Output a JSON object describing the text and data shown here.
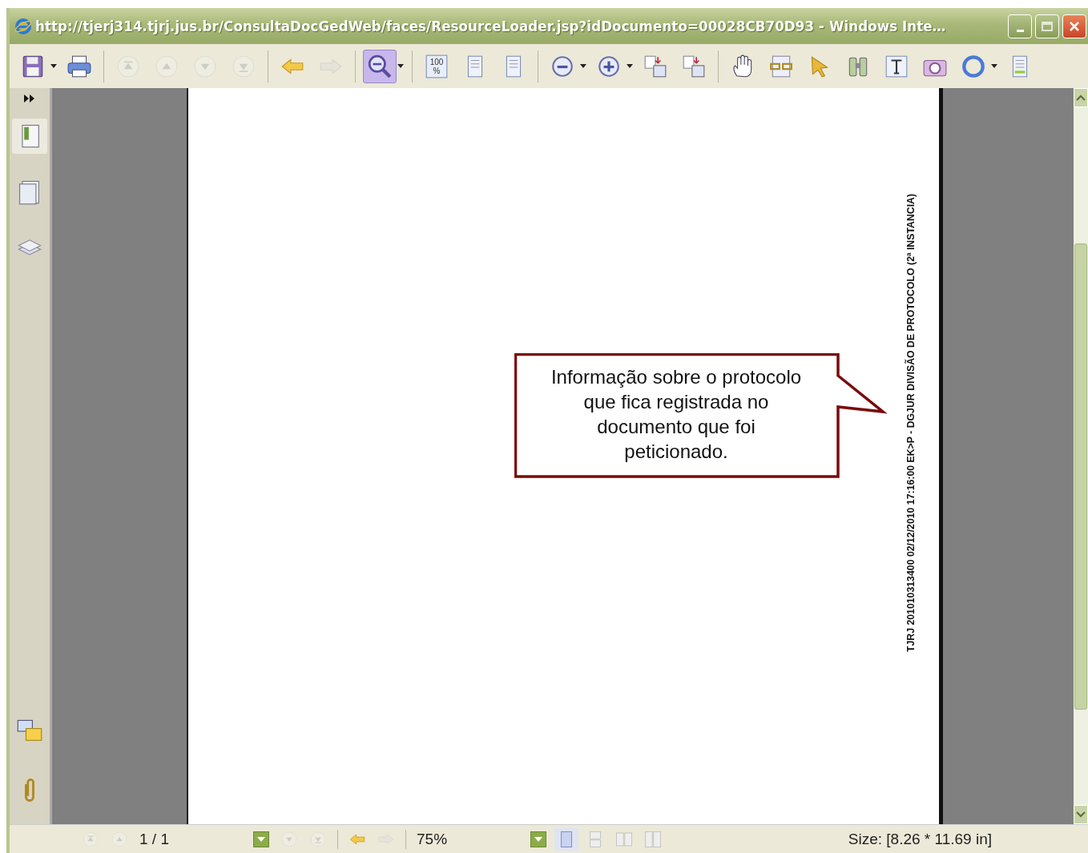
{
  "window": {
    "title": "http://tjerj314.tjrj.jus.br/ConsultaDocGedWeb/faces/ResourceLoader.jsp?idDocumento=00028CB70D93 - Windows Inte…"
  },
  "toolbar": [
    {
      "kind": "save",
      "disabled": false,
      "selected": false,
      "dropdown": true
    },
    {
      "kind": "print",
      "disabled": false,
      "selected": false
    },
    {
      "kind": "separator"
    },
    {
      "kind": "first",
      "disabled": true,
      "selected": false
    },
    {
      "kind": "prev",
      "disabled": true,
      "selected": false
    },
    {
      "kind": "next",
      "disabled": true,
      "selected": false
    },
    {
      "kind": "last",
      "disabled": true,
      "selected": false
    },
    {
      "kind": "separator"
    },
    {
      "kind": "back",
      "disabled": false,
      "selected": false
    },
    {
      "kind": "forward",
      "disabled": true,
      "selected": false
    },
    {
      "kind": "separator"
    },
    {
      "kind": "zoomtool",
      "disabled": false,
      "selected": true,
      "dropdown": true
    },
    {
      "kind": "separator"
    },
    {
      "kind": "actualsize",
      "label": "100 %",
      "disabled": false,
      "selected": false
    },
    {
      "kind": "fitpage",
      "disabled": false,
      "selected": false
    },
    {
      "kind": "fitwidth",
      "disabled": false,
      "selected": false
    },
    {
      "kind": "separator"
    },
    {
      "kind": "zoomout",
      "disabled": false,
      "selected": false,
      "dropdown": true
    },
    {
      "kind": "zoomin",
      "disabled": false,
      "selected": false,
      "dropdown": true
    },
    {
      "kind": "rotatecw",
      "disabled": false,
      "selected": false
    },
    {
      "kind": "rotateccw",
      "disabled": false,
      "selected": false
    },
    {
      "kind": "separator"
    },
    {
      "kind": "hand",
      "disabled": false,
      "selected": false
    },
    {
      "kind": "reading",
      "disabled": false,
      "selected": false
    },
    {
      "kind": "select",
      "disabled": false,
      "selected": false
    },
    {
      "kind": "find",
      "disabled": false,
      "selected": false
    },
    {
      "kind": "textselect",
      "disabled": false,
      "selected": false
    },
    {
      "kind": "snapshot",
      "disabled": false,
      "selected": false
    },
    {
      "kind": "circle",
      "disabled": false,
      "selected": false,
      "dropdown": true
    },
    {
      "kind": "textbox",
      "disabled": false,
      "selected": false
    }
  ],
  "sidebar": {
    "top": [
      {
        "kind": "bookmarks",
        "selected": true
      },
      {
        "kind": "pages",
        "selected": false
      },
      {
        "kind": "layers",
        "selected": false
      }
    ],
    "bottom": [
      {
        "kind": "comments",
        "selected": false
      },
      {
        "kind": "attachments",
        "selected": false
      }
    ]
  },
  "document": {
    "stamp": "TJRJ 201010313400 02/12/2010 17:16:00 EK>P - DGJUR DIVISÃO DE PROTOCOLO (2ª INSTANCIA)",
    "callout": "Informação sobre o protocolo\nque fica registrada no\ndocumento que foi\npeticionado."
  },
  "status_bar": {
    "items": [
      {
        "kind": "first",
        "disabled": true
      },
      {
        "kind": "prev",
        "disabled": true
      },
      {
        "kind": "field",
        "value": "1 / 1"
      },
      {
        "kind": "next",
        "disabled": true
      },
      {
        "kind": "last",
        "disabled": true
      },
      {
        "kind": "separator"
      },
      {
        "kind": "back",
        "disabled": false
      },
      {
        "kind": "forward",
        "disabled": true
      },
      {
        "kind": "separator"
      },
      {
        "kind": "field",
        "value": "75%"
      },
      {
        "kind": "single",
        "selected": true
      },
      {
        "kind": "continuous",
        "selected": false
      },
      {
        "kind": "facing",
        "selected": false
      },
      {
        "kind": "contfacing",
        "selected": false
      }
    ],
    "size": "Size: [8.26 * 11.69 in]"
  }
}
